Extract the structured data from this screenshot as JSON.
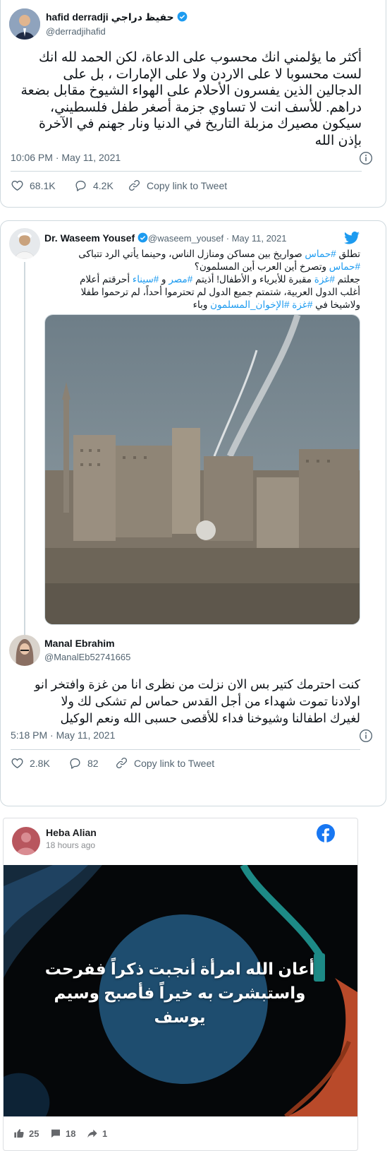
{
  "tweet1": {
    "author_name": "hafid derradji حفيظ دراجي",
    "handle": "@derradjihafid",
    "text_lines": [
      "أكثر ما يؤلمني انك محسوب على الدعاة، لكن الحمد لله انك",
      "لست محسوبا لا على الاردن ولا على الإمارات ، بل على",
      "الدجالين الذين يفسرون الأحلام على الهواء الشيوخ مقابل بضعة",
      "دراهم. للأسف انت لا تساوي جزمة أصغر طفل فلسطيني،",
      "سيكون مصيرك مزبلة التاريخ في الدنيا ونار جهنم في الآخرة",
      "بإذن الله"
    ],
    "timestamp": "10:06 PM · May 11, 2021",
    "likes": "68.1K",
    "replies": "4.2K",
    "copy_link": "Copy link to Tweet"
  },
  "tweet2": {
    "quoted": {
      "author_name": "Dr. Waseem Yousef",
      "handle_date": "@waseem_yousef · May 11, 2021",
      "line1_pre": "تطلق ",
      "line1_tag": "#حماس",
      "line1_post": " صواريخ بين مساكن ومنازل الناس، وحينما يأتي الرد تتباكى",
      "line2_tag": "#حماس",
      "line2_post": " وتصرخ أين العرب أين المسلمون؟",
      "line3_pre": "جعلتم ",
      "line3_tag1": "#غزة",
      "line3_mid": " مقبرة للأبرياء و الأطفال! أذيتم ",
      "line3_tag2": "#مصر",
      "line3_and": " و ",
      "line3_tag3": "#سيناء",
      "line3_post": " أحرقتم أعلام",
      "line4": "أغلب الدول العربية، شتمتم جميع الدول لم تحترموا أحداً، لم ترحموا طفلا",
      "line5_pre": "ولاشيخا في ",
      "line5_tag1": "#غزة",
      "line5_mid": " ",
      "line5_tag2": "#الإخوان_المسلمون",
      "line5_post": " وباء"
    },
    "author_name": "Manal Ebrahim",
    "handle": "@ManalEb52741665",
    "text_lines": [
      "كنت احترمك كتير بس الان نزلت من نظرى انا من غزة وافتخر انو",
      "اولادنا تموت شهداء من أجل القدس حماس لم تشكى لك ولا",
      "لغيرك اطفالنا وشيوخنا فداء للأقصى حسبى الله ونعم الوكيل"
    ],
    "timestamp": "5:18 PM · May 11, 2021",
    "likes": "2.8K",
    "replies": "82",
    "copy_link": "Copy link to Tweet"
  },
  "fbpost": {
    "author_name": "Heba Alian",
    "time": "18 hours ago",
    "image_text_line1": "أعان الله امرأة أنجبت ذكراً ففرحت",
    "image_text_line2": "واستبشرت به خيراً فأصبح وسيم يوسف",
    "likes": "25",
    "comments": "18",
    "shares": "1"
  },
  "colors": {
    "twitter_blue": "#1d9bf0",
    "facebook_blue": "#1877f2",
    "text_secondary": "#536471"
  }
}
